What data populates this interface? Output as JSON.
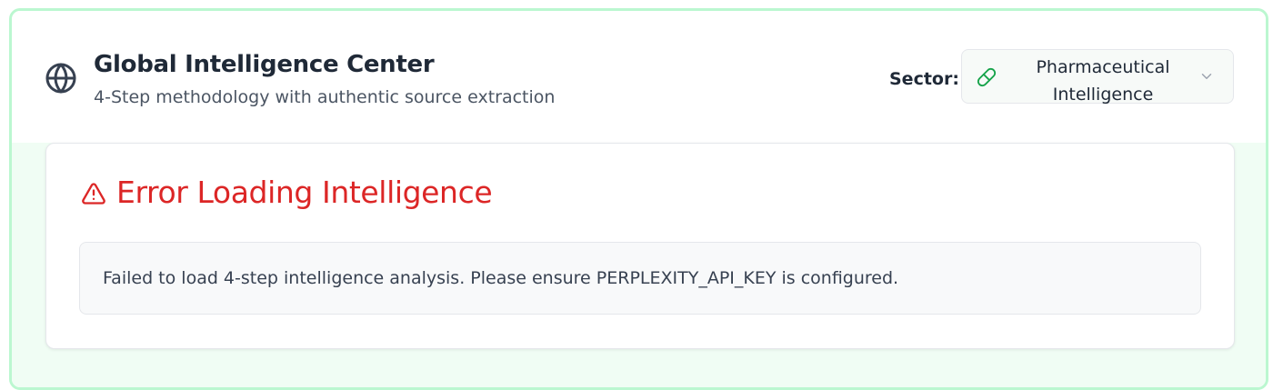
{
  "header": {
    "title": "Global Intelligence Center",
    "subtitle": "4-Step methodology with authentic source extraction",
    "icon": "globe-icon"
  },
  "sector": {
    "label": "Sector:",
    "selected_line1": "Pharmaceutical",
    "selected_line2": "Intelligence",
    "icon": "pill-icon",
    "dropdown_icon": "chevron-down-icon"
  },
  "error": {
    "title": "Error Loading Intelligence",
    "message": "Failed to load 4-step intelligence analysis. Please ensure PERPLEXITY_API_KEY is configured.",
    "icon": "alert-triangle-icon"
  },
  "colors": {
    "frame_border": "#bbf7d0",
    "content_background": "#f0fdf4",
    "error_red": "#dc2626",
    "pill_green": "#16a34a"
  }
}
